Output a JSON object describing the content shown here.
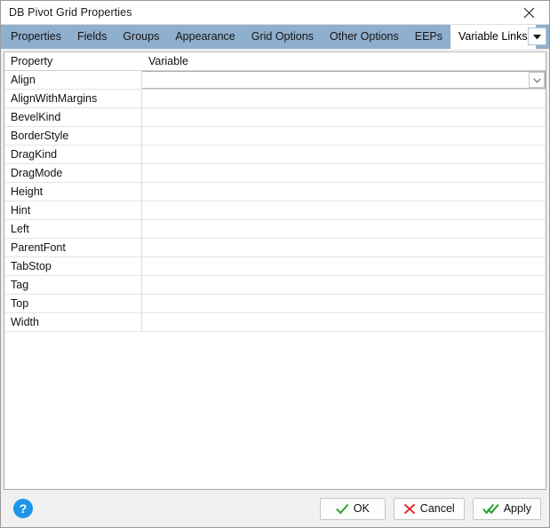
{
  "window": {
    "title": "DB Pivot Grid Properties",
    "close_icon": "close-icon"
  },
  "tabs": [
    {
      "label": "Properties",
      "active": false
    },
    {
      "label": "Fields",
      "active": false
    },
    {
      "label": "Groups",
      "active": false
    },
    {
      "label": "Appearance",
      "active": false
    },
    {
      "label": "Grid Options",
      "active": false
    },
    {
      "label": "Other Options",
      "active": false
    },
    {
      "label": "EEPs",
      "active": false
    },
    {
      "label": "Variable Links",
      "active": true
    }
  ],
  "tab_overflow_icon": "chevron-down-icon",
  "grid": {
    "columns": [
      "Property",
      "Variable"
    ],
    "rows": [
      {
        "property": "Align",
        "variable": "",
        "selected": true
      },
      {
        "property": "AlignWithMargins",
        "variable": "",
        "selected": false
      },
      {
        "property": "BevelKind",
        "variable": "",
        "selected": false
      },
      {
        "property": "BorderStyle",
        "variable": "",
        "selected": false
      },
      {
        "property": "DragKind",
        "variable": "",
        "selected": false
      },
      {
        "property": "DragMode",
        "variable": "",
        "selected": false
      },
      {
        "property": "Height",
        "variable": "",
        "selected": false
      },
      {
        "property": "Hint",
        "variable": "",
        "selected": false
      },
      {
        "property": "Left",
        "variable": "",
        "selected": false
      },
      {
        "property": "ParentFont",
        "variable": "",
        "selected": false
      },
      {
        "property": "TabStop",
        "variable": "",
        "selected": false
      },
      {
        "property": "Tag",
        "variable": "",
        "selected": false
      },
      {
        "property": "Top",
        "variable": "",
        "selected": false
      },
      {
        "property": "Width",
        "variable": "",
        "selected": false
      }
    ]
  },
  "footer": {
    "help_label": "?",
    "ok_label": "OK",
    "cancel_label": "Cancel",
    "apply_label": "Apply"
  },
  "colors": {
    "tabstrip": "#8fafce",
    "active_tab": "#ffffff",
    "help_blue": "#1e96e8",
    "check_green": "#2ca02c",
    "cancel_red": "#e03030",
    "dialog_bg": "#f0f0f0"
  }
}
